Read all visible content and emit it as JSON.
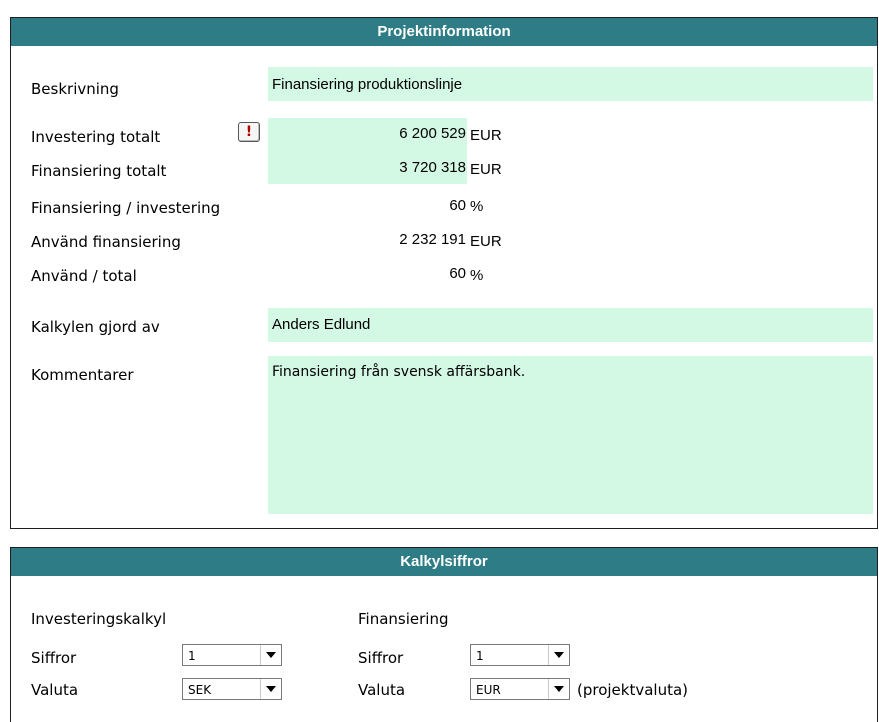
{
  "projekt": {
    "header": "Projektinformation",
    "beskrivning_label": "Beskrivning",
    "beskrivning_value": "Finansiering produktionslinje",
    "investering_label": "Investering totalt",
    "warning_icon": "!",
    "investering_value": "6 200 529",
    "investering_unit": "EUR",
    "finansiering_label": "Finansiering totalt",
    "finansiering_value": "3 720 318",
    "finansiering_unit": "EUR",
    "ratio_label": "Finansiering / investering",
    "ratio_value": "60",
    "ratio_unit": "%",
    "anvand_label": "Använd finansiering",
    "anvand_value": "2 232 191",
    "anvand_unit": "EUR",
    "anvand_total_label": "Använd / total",
    "anvand_total_value": "60",
    "anvand_total_unit": "%",
    "kalkyl_label": "Kalkylen gjord av",
    "kalkyl_value": "Anders Edlund",
    "kommentar_label": "Kommentarer",
    "kommentar_value": "Finansiering från svensk affärsbank."
  },
  "kalkyl": {
    "header": "Kalkylsiffror",
    "invest_heading": "Investeringskalkyl",
    "fin_heading": "Finansiering",
    "siffror_label": "Siffror",
    "valuta_label": "Valuta",
    "invest_siffror": "1",
    "invest_valuta": "SEK",
    "fin_siffror": "1",
    "fin_valuta": "EUR",
    "projektvaluta_note": "(projektvaluta)"
  },
  "colors": {
    "header_bg": "#2e7d86",
    "field_bg": "#d3f8e4",
    "warning": "#b00000"
  }
}
